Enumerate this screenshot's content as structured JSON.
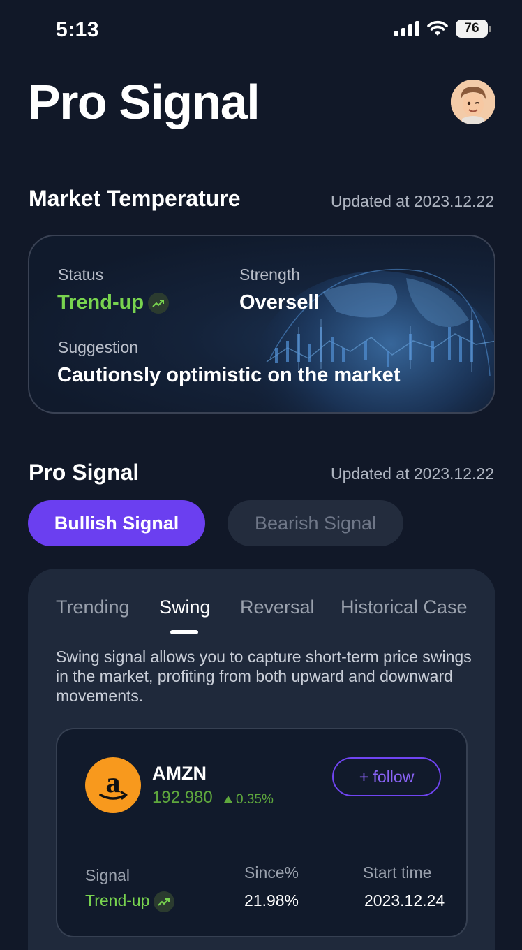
{
  "status_bar": {
    "time": "5:13",
    "battery": "76"
  },
  "header": {
    "title": "Pro Signal"
  },
  "market_temperature": {
    "title": "Market Temperature",
    "updated": "Updated at 2023.12.22",
    "status_label": "Status",
    "status_value": "Trend-up",
    "strength_label": "Strength",
    "strength_value": "Oversell",
    "suggestion_label": "Suggestion",
    "suggestion_value": "Cautionsly optimistic on the market"
  },
  "pro_signal": {
    "title": "Pro Signal",
    "updated": "Updated at 2023.12.22",
    "bullish_label": "Bullish Signal",
    "bearish_label": "Bearish Signal",
    "tabs": [
      {
        "label": "Trending"
      },
      {
        "label": "Swing"
      },
      {
        "label": "Reversal"
      },
      {
        "label": "Historical Case"
      }
    ],
    "active_tab": "Swing",
    "description": "Swing signal allows you to capture short-term price swings in the market, profiting from both upward and downward movements.",
    "stock": {
      "ticker": "AMZN",
      "price": "192.980",
      "change": "0.35%",
      "follow_label": "+ follow",
      "signal_label": "Signal",
      "signal_value": "Trend-up",
      "since_label": "Since%",
      "since_value": "21.98%",
      "start_label": "Start time",
      "start_value": "2023.12.24"
    }
  },
  "colors": {
    "background": "#111828",
    "accent": "#6b3ff0",
    "trend_green": "#78d34f",
    "price_green": "#5fa83d",
    "logo_orange": "#f8991d"
  },
  "icons": [
    "cellular-signal-icon",
    "wifi-icon",
    "battery-icon",
    "avatar-memoji",
    "trend-up-icon",
    "amazon-logo",
    "up-triangle-icon"
  ]
}
